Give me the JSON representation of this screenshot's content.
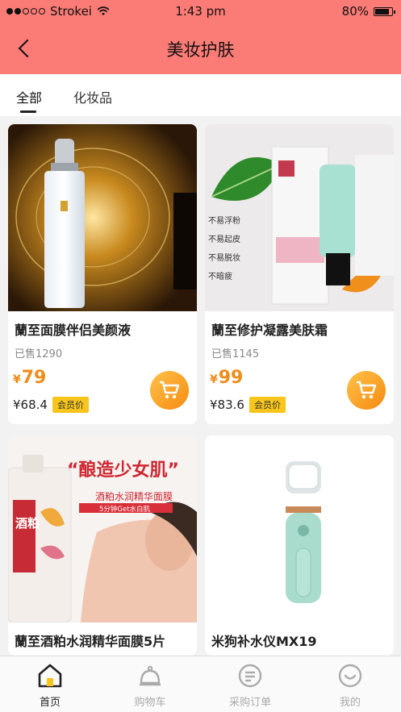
{
  "status": {
    "carrier": "Strokei",
    "time": "1:43 pm",
    "battery": "80%"
  },
  "nav": {
    "title": "美妆护肤"
  },
  "tabs": [
    {
      "label": "全部",
      "active": true
    },
    {
      "label": "化妆品",
      "active": false
    }
  ],
  "products": [
    {
      "name": "蘭至面膜伴侣美颜液",
      "sold": "已售1290",
      "currency": "¥",
      "price": "79",
      "member_price": "¥68.4",
      "member_label": "会员价"
    },
    {
      "name": "蘭至修护凝露美肤霜",
      "sold": "已售1145",
      "currency": "¥",
      "price": "99",
      "member_price": "¥83.6",
      "member_label": "会员价"
    },
    {
      "name": "蘭至酒粕水润精华面膜5片"
    },
    {
      "name": "米狗补水仪MX19"
    }
  ],
  "image_text": {
    "p3_slogan": "“酿造少女肌”",
    "p3_sub": "酒粕水润精华面膜",
    "p3_red": "5分钟Get水白肌",
    "p3_pack": "酒粕",
    "p2_lines": [
      "不易浮粉",
      "不易起皮",
      "不易脱妆",
      "不暗疲"
    ]
  },
  "tabbar": [
    {
      "label": "首页",
      "icon": "home-icon",
      "active": true
    },
    {
      "label": "购物车",
      "icon": "cart-bell-icon",
      "active": false
    },
    {
      "label": "采购订单",
      "icon": "order-list-icon",
      "active": false
    },
    {
      "label": "我的",
      "icon": "smile-icon",
      "active": false
    }
  ],
  "colors": {
    "header": "#fb7b76",
    "price": "#f08c1a",
    "badge": "#f7c51b",
    "cart_button": "#f58a10"
  }
}
